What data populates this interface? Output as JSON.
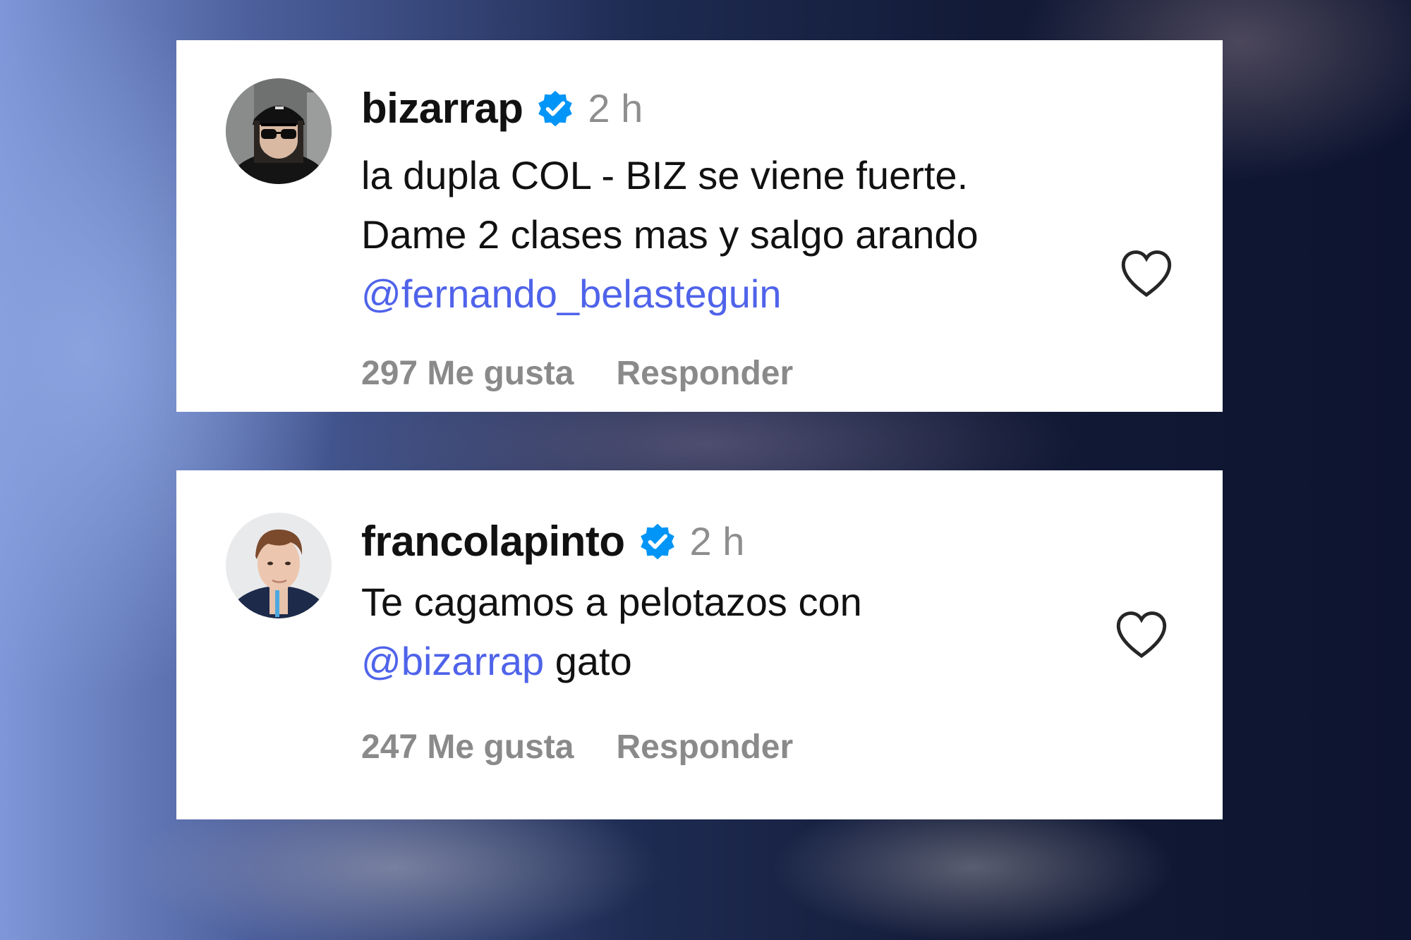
{
  "comments": [
    {
      "username": "bizarrap",
      "verified_icon": "verified-badge-icon",
      "time": "2 h",
      "lines": [
        "la dupla COL - BIZ se viene fuerte.",
        "Dame 2 clases mas y salgo arando"
      ],
      "mention": "@fernando_belasteguin",
      "likes": "297 Me gusta",
      "reply": "Responder",
      "like_icon": "heart-outline-icon"
    },
    {
      "username": "francolapinto",
      "verified_icon": "verified-badge-icon",
      "time": "2 h",
      "line1": "Te cagamos a pelotazos con",
      "mention": "@bizarrap",
      "after_mention": " gato",
      "likes": "247 Me gusta",
      "reply": "Responder",
      "like_icon": "heart-outline-icon"
    }
  ],
  "colors": {
    "mention": "#4f63ea",
    "verified": "#0095f6",
    "muted": "#8e8e8e",
    "text": "#111111"
  }
}
